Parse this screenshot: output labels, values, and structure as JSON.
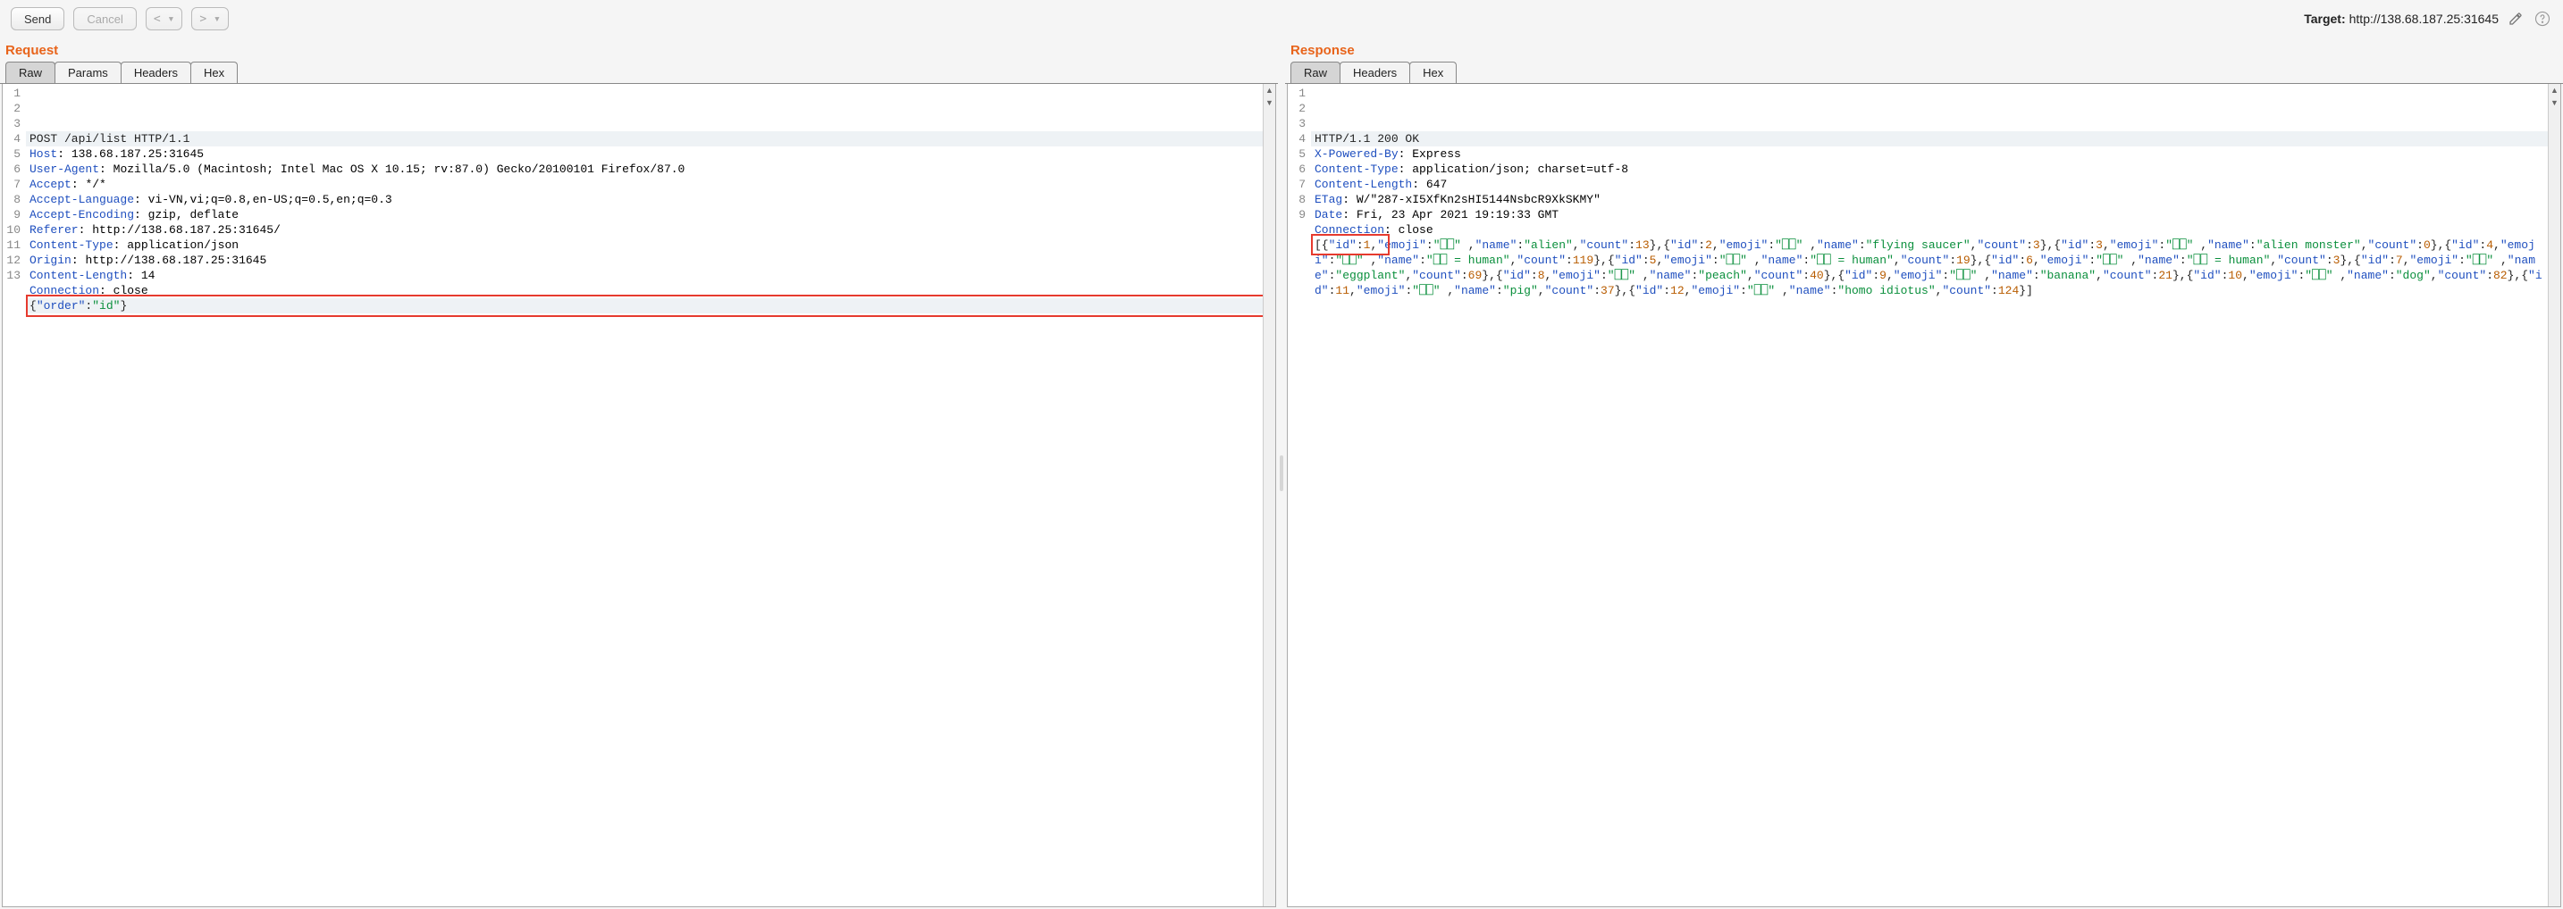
{
  "toolbar": {
    "send_label": "Send",
    "cancel_label": "Cancel",
    "prev_label": "< ▾",
    "next_label": "> ▾"
  },
  "target": {
    "label": "Target:",
    "value": "http://138.68.187.25:31645"
  },
  "request": {
    "title": "Request",
    "tabs": [
      "Raw",
      "Params",
      "Headers",
      "Hex"
    ],
    "active_tab": 0,
    "lines": [
      "POST /api/list HTTP/1.1",
      "Host: 138.68.187.25:31645",
      "User-Agent: Mozilla/5.0 (Macintosh; Intel Mac OS X 10.15; rv:87.0) Gecko/20100101 Firefox/87.0",
      "Accept: */*",
      "Accept-Language: vi-VN,vi;q=0.8,en-US;q=0.5,en;q=0.3",
      "Accept-Encoding: gzip, deflate",
      "Referer: http://138.68.187.25:31645/",
      "Content-Type: application/json",
      "Origin: http://138.68.187.25:31645",
      "Content-Length: 14",
      "Connection: close",
      "",
      "{\"order\":\"id\"}"
    ]
  },
  "response": {
    "title": "Response",
    "tabs": [
      "Raw",
      "Headers",
      "Hex"
    ],
    "active_tab": 0,
    "headers": [
      "HTTP/1.1 200 OK",
      "X-Powered-By: Express",
      "Content-Type: application/json; charset=utf-8",
      "Content-Length: 647",
      "ETag: W/\"287-xI5XfKn2sHI5144NsbcR9XkSKMY\"",
      "Date: Fri, 23 Apr 2021 19:19:33 GMT",
      "Connection: close",
      ""
    ],
    "body_items": [
      {
        "id": 1,
        "emoji": "⎕⎕",
        "name": "alien",
        "count": 13
      },
      {
        "id": 2,
        "emoji": "⎕⎕",
        "name": "flying saucer",
        "count": 3
      },
      {
        "id": 3,
        "emoji": "⎕⎕",
        "name": "alien monster",
        "count": 0
      },
      {
        "id": 4,
        "emoji": "⎕⎕",
        "name": "⎕⎕ = human",
        "count": 119
      },
      {
        "id": 5,
        "emoji": "⎕⎕",
        "name": "⎕⎕ = human",
        "count": 19
      },
      {
        "id": 6,
        "emoji": "⎕⎕",
        "name": "⎕⎕ = human",
        "count": 3
      },
      {
        "id": 7,
        "emoji": "⎕⎕",
        "name": "eggplant",
        "count": 69
      },
      {
        "id": 8,
        "emoji": "⎕⎕",
        "name": "peach",
        "count": 40
      },
      {
        "id": 9,
        "emoji": "⎕⎕",
        "name": "banana",
        "count": 21
      },
      {
        "id": 10,
        "emoji": "⎕⎕",
        "name": "dog",
        "count": 82
      },
      {
        "id": 11,
        "emoji": "⎕⎕",
        "name": "pig",
        "count": 37
      },
      {
        "id": 12,
        "emoji": "⎕⎕",
        "name": "homo idiotus",
        "count": 124
      }
    ]
  },
  "icons": {
    "edit": "pencil-icon",
    "help": "help-icon"
  }
}
